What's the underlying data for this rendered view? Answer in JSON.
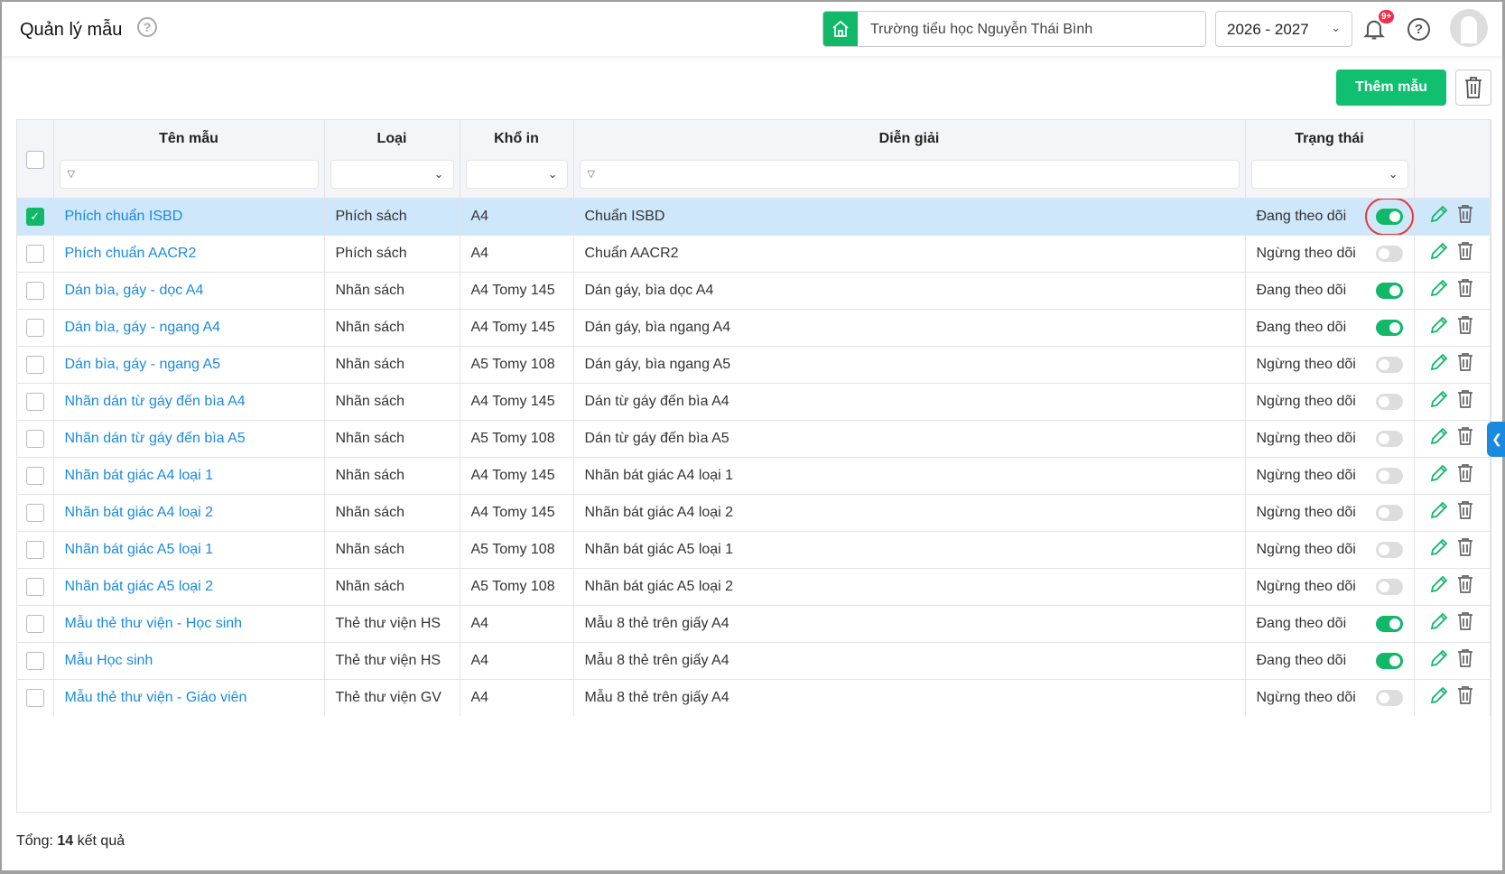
{
  "header": {
    "title": "Quản lý mẫu",
    "school": "Trường tiểu học Nguyễn Thái Bình",
    "year": "2026 - 2027",
    "notif_badge": "9+"
  },
  "toolbar": {
    "add_label": "Thêm mẫu"
  },
  "table": {
    "columns": [
      "Tên mẫu",
      "Loại",
      "Khổ in",
      "Diễn giải",
      "Trạng thái"
    ],
    "rows": [
      {
        "name": "Phích chuẩn ISBD",
        "type": "Phích sách",
        "size": "A4",
        "desc": "Chuẩn ISBD",
        "status": "Đang theo dõi",
        "on": true,
        "checked": true
      },
      {
        "name": "Phích chuẩn AACR2",
        "type": "Phích sách",
        "size": "A4",
        "desc": "Chuẩn AACR2",
        "status": "Ngừng theo dõi",
        "on": false
      },
      {
        "name": "Dán bìa, gáy - dọc A4",
        "type": "Nhãn sách",
        "size": "A4 Tomy 145",
        "desc": "Dán gáy, bìa dọc A4",
        "status": "Đang theo dõi",
        "on": true
      },
      {
        "name": "Dán bìa, gáy - ngang A4",
        "type": "Nhãn sách",
        "size": "A4 Tomy 145",
        "desc": "Dán gáy, bìa ngang A4",
        "status": "Đang theo dõi",
        "on": true
      },
      {
        "name": "Dán bìa, gáy - ngang A5",
        "type": "Nhãn sách",
        "size": "A5 Tomy 108",
        "desc": "Dán gáy, bìa ngang A5",
        "status": "Ngừng theo dõi",
        "on": false
      },
      {
        "name": "Nhãn dán từ gáy đến bìa A4",
        "type": "Nhãn sách",
        "size": "A4 Tomy 145",
        "desc": "Dán từ gáy đến bìa A4",
        "status": "Ngừng theo dõi",
        "on": false
      },
      {
        "name": "Nhãn dán từ gáy đến bìa A5",
        "type": "Nhãn sách",
        "size": "A5 Tomy 108",
        "desc": "Dán từ gáy đến bìa A5",
        "status": "Ngừng theo dõi",
        "on": false
      },
      {
        "name": "Nhãn bát giác A4 loại 1",
        "type": "Nhãn sách",
        "size": "A4 Tomy 145",
        "desc": "Nhãn bát giác A4 loại 1",
        "status": "Ngừng theo dõi",
        "on": false
      },
      {
        "name": "Nhãn bát giác A4 loại 2",
        "type": "Nhãn sách",
        "size": "A4 Tomy 145",
        "desc": "Nhãn bát giác A4 loại 2",
        "status": "Ngừng theo dõi",
        "on": false
      },
      {
        "name": "Nhãn bát giác A5 loại 1",
        "type": "Nhãn sách",
        "size": "A5 Tomy 108",
        "desc": "Nhãn bát giác A5 loại 1",
        "status": "Ngừng theo dõi",
        "on": false
      },
      {
        "name": "Nhãn bát giác A5 loại 2",
        "type": "Nhãn sách",
        "size": "A5 Tomy 108",
        "desc": "Nhãn bát giác A5 loại 2",
        "status": "Ngừng theo dõi",
        "on": false
      },
      {
        "name": "Mẫu thẻ thư viện - Học sinh",
        "type": "Thẻ thư viện HS",
        "size": "A4",
        "desc": "Mẫu 8 thẻ trên giấy A4",
        "status": "Đang theo dõi",
        "on": true
      },
      {
        "name": "Mẫu Học sinh",
        "type": "Thẻ thư viện HS",
        "size": "A4",
        "desc": "Mẫu 8 thẻ trên giấy A4",
        "status": "Đang theo dõi",
        "on": true
      },
      {
        "name": "Mẫu thẻ thư viện - Giáo viên",
        "type": "Thẻ thư viện GV",
        "size": "A4",
        "desc": "Mẫu 8 thẻ trên giấy A4",
        "status": "Ngừng theo dõi",
        "on": false
      }
    ]
  },
  "footer": {
    "prefix": "Tổng:",
    "count": "14",
    "suffix": "kết quả"
  }
}
